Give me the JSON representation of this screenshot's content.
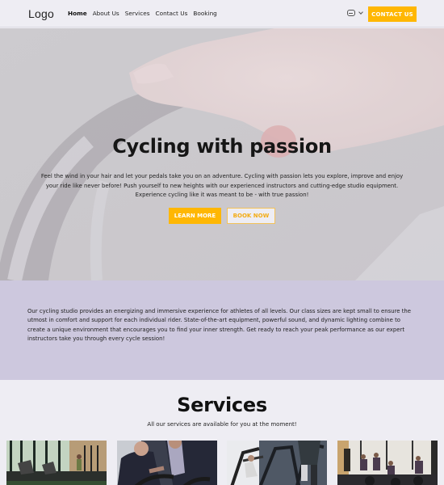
{
  "nav": {
    "logo": "Logo",
    "items": [
      {
        "label": "Home",
        "active": true
      },
      {
        "label": "About Us",
        "active": false
      },
      {
        "label": "Services",
        "active": false
      },
      {
        "label": "Contact Us",
        "active": false
      },
      {
        "label": "Booking",
        "active": false
      }
    ],
    "language_icon": "globe-icon",
    "language_chevron": "chevron-down-icon",
    "contact_button": "CONTACT US"
  },
  "hero": {
    "title": "Cycling with passion",
    "text": "Feel the wind in your hair and let your pedals take you on an adventure. Cycling with passion lets you explore, improve and enjoy your ride like never before! Push yourself to new heights with our experienced instructors and cutting-edge studio equipment. Experience cycling like it was meant to be - with true passion!",
    "learn_more": "LEARN MORE",
    "book_now": "BOOK NOW",
    "image": "hand-on-bike-handlebar"
  },
  "about": {
    "text": "Our cycling studio provides an energizing and immersive experience for athletes of all levels. Our class sizes are kept small to ensure the utmost in comfort and support for each individual rider. State-of-the-art equipment, powerful sound, and dynamic lighting combine to create a unique environment that encourages you to find your inner strength. Get ready to reach your peak performance as our expert instructors take you through every cycle session!"
  },
  "services": {
    "title": "Services",
    "subtitle": "All our services are available for you at the moment!",
    "cards": [
      {
        "image": "treadmill-gym-window"
      },
      {
        "image": "trainer-coaching-cyclist"
      },
      {
        "image": "stair-climber-machines"
      },
      {
        "image": "group-spin-class"
      }
    ]
  },
  "colors": {
    "accent": "#ffb703",
    "background": "#eeedf3",
    "about_band": "#cdc8de"
  }
}
